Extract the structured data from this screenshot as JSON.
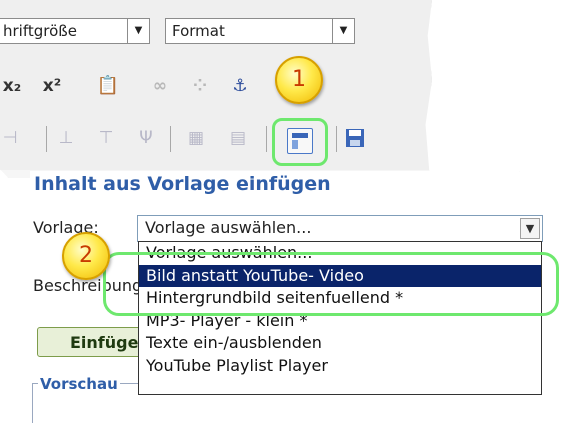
{
  "toolbar": {
    "font_size_label": "hriftgröße",
    "format_label": "Format",
    "dropdown_arrow": "▼",
    "icons_row1": [
      "x₂",
      "x²",
      "📋",
      "∞",
      "⁘",
      "⚓"
    ],
    "icons_row2": [
      "⊣",
      "⊥",
      "⊤",
      "Ψ",
      "▦",
      "▤"
    ]
  },
  "badges": {
    "one": "1",
    "two": "2"
  },
  "dialog": {
    "title": "Inhalt aus Vorlage einfügen",
    "template_label": "Vorlage:",
    "select_value": "Vorlage auswählen...",
    "description_label": "Beschreibung:",
    "insert_button": "Einfügen",
    "preview_label": "Vorschau"
  },
  "dropdown": {
    "options": [
      "Vorlage auswählen...",
      "Bild anstatt YouTube- Video",
      "Hintergrundbild seitenfuellend *",
      "MP3- Player - klein *",
      "Texte ein-/ausblenden",
      "YouTube Playlist Player"
    ],
    "selected_index": 1
  },
  "colors": {
    "highlight_ring": "#6ee86e",
    "selected_option": "#0a246a",
    "title_blue": "#2f5ea8",
    "badge": "#ffe94a"
  }
}
